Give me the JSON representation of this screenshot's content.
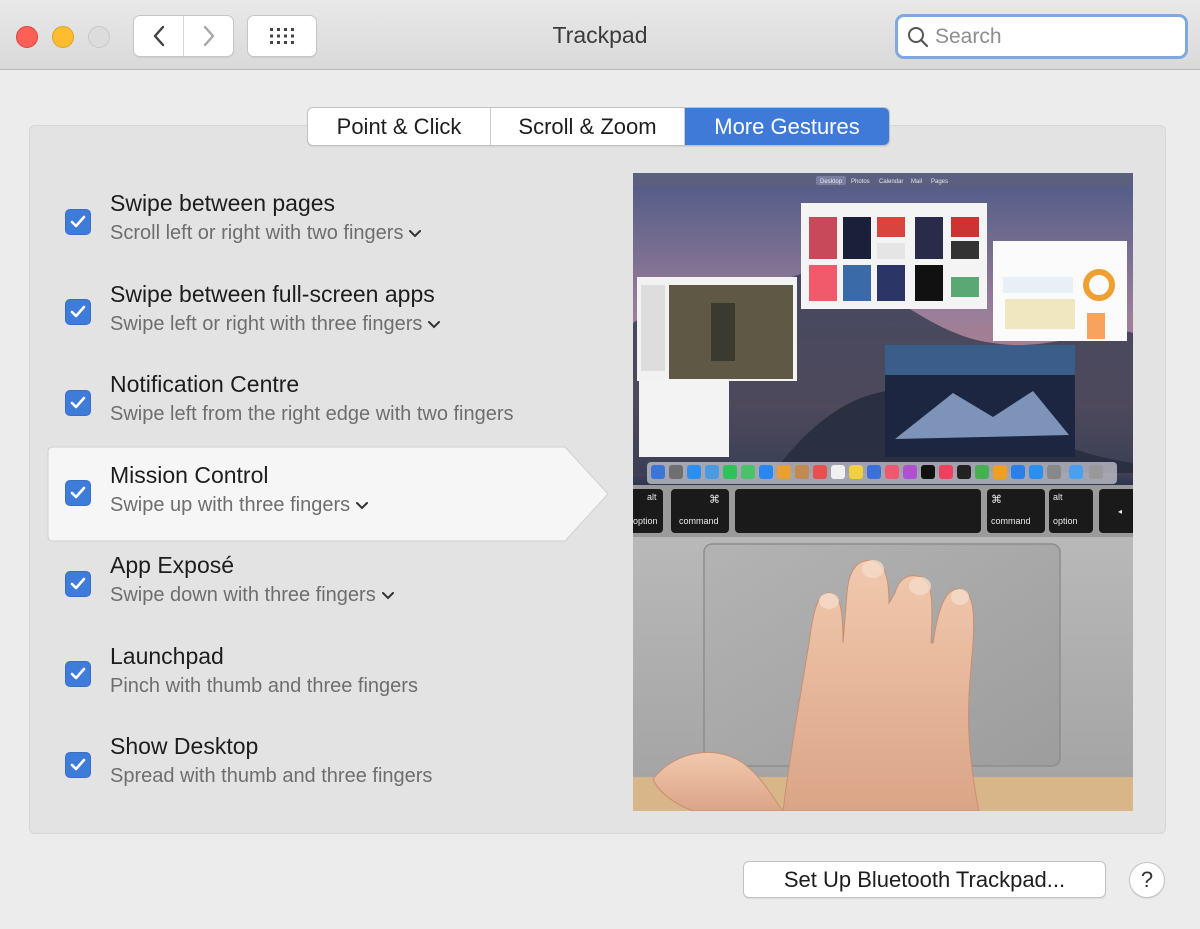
{
  "window": {
    "title": "Trackpad",
    "search_placeholder": "Search"
  },
  "toolbar": {
    "back_glyph": "‹",
    "forward_glyph": "›",
    "show_all_icon": "grid-icon"
  },
  "tabs": [
    {
      "label": "Point & Click",
      "active": false
    },
    {
      "label": "Scroll & Zoom",
      "active": false
    },
    {
      "label": "More Gestures",
      "active": true
    }
  ],
  "gestures": [
    {
      "title": "Swipe between pages",
      "subtitle": "Scroll left or right with two fingers",
      "checked": true,
      "has_menu": true
    },
    {
      "title": "Swipe between full-screen apps",
      "subtitle": "Swipe left or right with three fingers",
      "checked": true,
      "has_menu": true
    },
    {
      "title": "Notification Centre",
      "subtitle": "Swipe left from the right edge with two fingers",
      "checked": true,
      "has_menu": false
    },
    {
      "title": "Mission Control",
      "subtitle": "Swipe up with three fingers",
      "checked": true,
      "has_menu": true,
      "selected": true
    },
    {
      "title": "App Exposé",
      "subtitle": "Swipe down with three fingers",
      "checked": true,
      "has_menu": true
    },
    {
      "title": "Launchpad",
      "subtitle": "Pinch with thumb and three fingers",
      "checked": true,
      "has_menu": false
    },
    {
      "title": "Show Desktop",
      "subtitle": "Spread with thumb and three fingers",
      "checked": true,
      "has_menu": false
    }
  ],
  "preview": {
    "menubar_items": [
      "Desktop",
      "Photos",
      "Calendar",
      "Mail",
      "Pages"
    ],
    "keys": {
      "option": "option",
      "command": "command",
      "alt": "alt",
      "cmd_symbol": "⌘"
    }
  },
  "footer": {
    "setup_button": "Set Up Bluetooth Trackpad...",
    "help_button": "?"
  },
  "colors": {
    "accent": "#3f7ad8",
    "close": "#fe5f57",
    "minimize": "#febc2e",
    "search_focus": "#7fa8e0"
  }
}
